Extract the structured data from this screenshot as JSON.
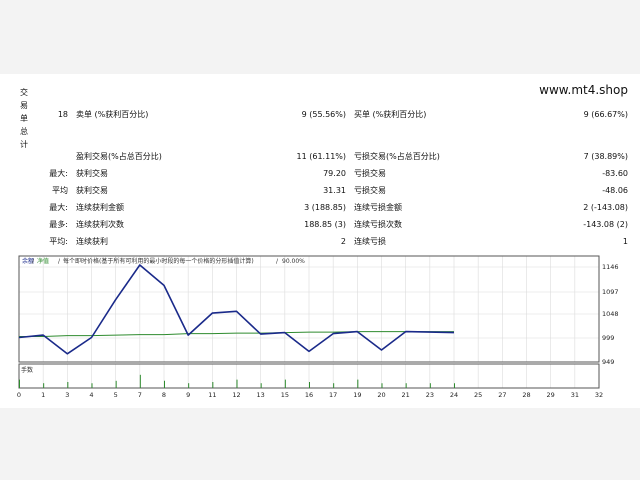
{
  "brand": "www.mt4.shop",
  "summary": {
    "vertical_label": [
      "交",
      "易",
      "单",
      "总",
      "计"
    ],
    "count": "18",
    "short_label": "卖单 (%获利百分比)",
    "short_value": "9 (55.56%)",
    "long_label": "买单 (%获利百分比)",
    "long_value": "9 (66.67%)",
    "profit_trades_label": "盈利交易(%占总百分比)",
    "profit_trades_value": "11 (61.11%)",
    "loss_trades_label": "亏损交易(%占总百分比)",
    "loss_trades_value": "7 (38.89%)",
    "rows": [
      {
        "prefix": "最大:",
        "l_label": "获利交易",
        "l_value": "79.20",
        "r_label": "亏损交易",
        "r_value": "-83.60"
      },
      {
        "prefix": "平均",
        "l_label": "获利交易",
        "l_value": "31.31",
        "r_label": "亏损交易",
        "r_value": "-48.06"
      },
      {
        "prefix": "最大:",
        "l_label": "连续获利金额",
        "l_value": "3 (188.85)",
        "r_label": "连续亏损金额",
        "r_value": "2 (-143.08)"
      },
      {
        "prefix": "最多:",
        "l_label": "连续获利次数",
        "l_value": "188.85 (3)",
        "r_label": "连续亏损次数",
        "r_value": "-143.08 (2)"
      },
      {
        "prefix": "平均:",
        "l_label": "连续获利",
        "l_value": "2",
        "r_label": "连续亏损",
        "r_value": "1"
      }
    ]
  },
  "chart_data": {
    "type": "line",
    "header": {
      "balance_label": "余额",
      "sep1": "/",
      "equity_label": "净值",
      "sep2": "/",
      "description": "每个即时价格(基于所有可利用的最小时段的每一个价格的分形插值计算)",
      "sep3": "/",
      "quality": "90.00%"
    },
    "y_ticks": [
      "1146",
      "1097",
      "1048",
      "999",
      "949"
    ],
    "ylim": [
      949,
      1170
    ],
    "x_ticks": [
      "0",
      "1",
      "3",
      "4",
      "5",
      "7",
      "8",
      "9",
      "11",
      "12",
      "13",
      "15",
      "16",
      "17",
      "19",
      "20",
      "21",
      "23",
      "24",
      "25",
      "27",
      "28",
      "29",
      "31",
      "32"
    ],
    "x": [
      0,
      1,
      2,
      3,
      4,
      5,
      6,
      7,
      8,
      9,
      10,
      11,
      12,
      13,
      14,
      15,
      16,
      17,
      18
    ],
    "series": [
      {
        "role": "balance",
        "color": "#1a2a8a",
        "values": [
          1000,
          1005,
          966,
          1000,
          1080,
          1150,
          1110,
          1005,
          1050,
          1054,
          1007,
          1010,
          971,
          1008,
          1012,
          974,
          1012,
          1011,
          1010
        ]
      },
      {
        "role": "equity",
        "color": "#2e8b2e",
        "values": [
          1002,
          1002,
          1004,
          1004,
          1005,
          1006,
          1006,
          1008,
          1008,
          1009,
          1009,
          1010,
          1011,
          1011,
          1012,
          1012,
          1012,
          1012,
          1012
        ]
      }
    ],
    "volume_label": "手数",
    "volume": [
      0.35,
      0.2,
      0.25,
      0.2,
      0.3,
      0.55,
      0.3,
      0.2,
      0.25,
      0.35,
      0.2,
      0.35,
      0.25,
      0.2,
      0.35,
      0.2,
      0.2,
      0.2,
      0.2
    ],
    "grid": true
  }
}
